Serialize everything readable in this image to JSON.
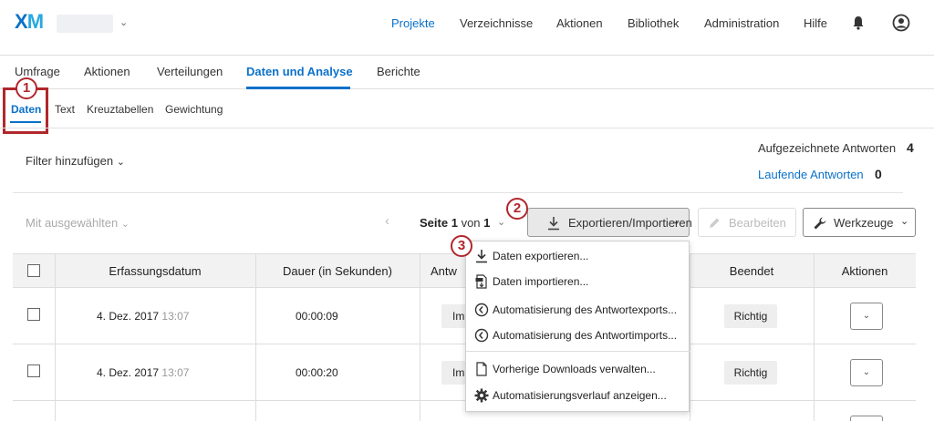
{
  "brand": {
    "logo_x": "X",
    "logo_m": "M"
  },
  "topnav": {
    "items": [
      "Projekte",
      "Verzeichnisse",
      "Aktionen",
      "Bibliothek",
      "Administration",
      "Hilfe"
    ],
    "active": "Projekte"
  },
  "tabs": {
    "items": [
      "Umfrage",
      "Aktionen",
      "Verteilungen",
      "Daten und Analyse",
      "Berichte"
    ],
    "active": "Daten und Analyse"
  },
  "subtabs": {
    "items": [
      "Daten",
      "Text",
      "Kreuztabellen",
      "Gewichtung"
    ],
    "active": "Daten"
  },
  "callouts": [
    "1",
    "2",
    "3"
  ],
  "filter": {
    "label": "Filter hinzufügen"
  },
  "stats": {
    "recorded_label": "Aufgezeichnete Antworten",
    "recorded_value": "4",
    "ongoing_label": "Laufende Antworten",
    "ongoing_value": "0"
  },
  "toolbar": {
    "with_selected": "Mit ausgewählten",
    "page_word": "Seite",
    "page_current": "1",
    "page_of": "von",
    "page_total": "1",
    "export_label": "Exportieren/Importieren",
    "edit_label": "Bearbeiten",
    "tools_label": "Werkzeuge"
  },
  "table": {
    "headers": [
      "Erfassungsdatum",
      "Dauer (in Sekunden)",
      "Antw",
      "Beendet",
      "Aktionen"
    ],
    "rows": [
      {
        "date": "4. Dez. 2017",
        "time": "13:07",
        "duration": "00:00:09",
        "type": "Imp",
        "finished": "Richtig"
      },
      {
        "date": "4. Dez. 2017",
        "time": "13:07",
        "duration": "00:00:20",
        "type": "Imp",
        "finished": "Richtig"
      }
    ]
  },
  "menu": {
    "items": [
      "Daten exportieren...",
      "Daten importieren...",
      "Automatisierung des Antwortexports...",
      "Automatisierung des Antwortimports...",
      "Vorherige Downloads verwalten...",
      "Automatisierungsverlauf anzeigen..."
    ]
  },
  "colors": {
    "accent": "#0b71c9",
    "callout": "#b0272c"
  }
}
